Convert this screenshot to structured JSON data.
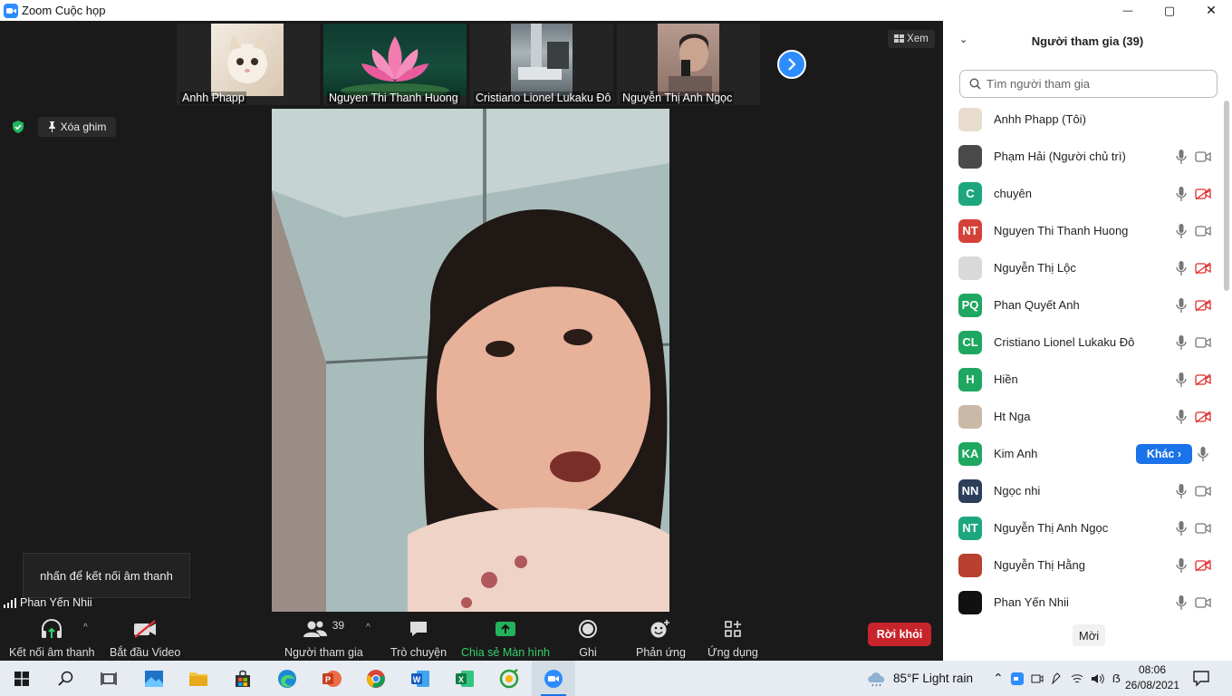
{
  "window": {
    "title": "Zoom Cuộc họp",
    "minimize": "—",
    "maximize": "▢",
    "close": "✕"
  },
  "gallery": {
    "thumbnails": [
      {
        "name": "Anhh Phapp"
      },
      {
        "name": "Nguyen Thi Thanh Huong"
      },
      {
        "name": "Cristiano Lionel Lukaku Đô"
      },
      {
        "name": "Nguyễn Thị Anh Ngọc"
      }
    ],
    "view_label": "Xem"
  },
  "unpin_label": "Xóa ghim",
  "audio_tooltip": "nhấn để kết nối âm thanh",
  "self_name": "Phan Yến Nhii",
  "toolbar": {
    "audio": "Kết nối âm thanh",
    "video": "Bắt đầu Video",
    "participants": "Người tham gia",
    "participants_count": "39",
    "chat": "Trò chuyện",
    "share": "Chia sẻ Màn hình",
    "record": "Ghi",
    "reactions": "Phản ứng",
    "apps": "Ứng dụng",
    "leave": "Rời khỏi"
  },
  "panel": {
    "title": "Người tham gia (39)",
    "search_placeholder": "Tìm người tham gia",
    "invite": "Mời",
    "more_label": "Khác",
    "participants": [
      {
        "name": "Anhh Phapp (Tôi)",
        "avatar": "",
        "avatar_color": "#e8dccf",
        "mic": false,
        "cam": "none"
      },
      {
        "name": "Phạm Hải (Người chủ trì)",
        "avatar": "",
        "avatar_color": "#4a4a4a",
        "mic": true,
        "cam": "on"
      },
      {
        "name": "chuyên",
        "avatar": "C",
        "avatar_color": "#1ea77f",
        "mic": true,
        "cam": "off"
      },
      {
        "name": "Nguyen Thi Thanh Huong",
        "avatar": "NT",
        "avatar_color": "#d4413a",
        "mic": true,
        "cam": "on"
      },
      {
        "name": "Nguyễn Thị Lộc",
        "avatar": "",
        "avatar_color": "#d9d9d9",
        "mic": true,
        "cam": "off"
      },
      {
        "name": "Phan Quyết Anh",
        "avatar": "PQ",
        "avatar_color": "#1ea760",
        "mic": true,
        "cam": "off"
      },
      {
        "name": "Cristiano Lionel Lukaku Đô",
        "avatar": "CL",
        "avatar_color": "#1ea760",
        "mic": true,
        "cam": "on"
      },
      {
        "name": "Hiền",
        "avatar": "H",
        "avatar_color": "#1ea760",
        "mic": true,
        "cam": "off"
      },
      {
        "name": "Ht Nga",
        "avatar": "",
        "avatar_color": "#cbb9a8",
        "mic": true,
        "cam": "off"
      },
      {
        "name": "Kim Anh",
        "avatar": "KA",
        "avatar_color": "#1ea760",
        "mic": true,
        "cam": "more"
      },
      {
        "name": "Ngọc nhi",
        "avatar": "NN",
        "avatar_color": "#2c3e5a",
        "mic": true,
        "cam": "on"
      },
      {
        "name": "Nguyễn Thị Anh Ngọc",
        "avatar": "NT",
        "avatar_color": "#1ea77f",
        "mic": true,
        "cam": "on"
      },
      {
        "name": "Nguyễn Thị Hằng",
        "avatar": "",
        "avatar_color": "#b8412f",
        "mic": true,
        "cam": "off"
      },
      {
        "name": "Phan Yến Nhii",
        "avatar": "",
        "avatar_color": "#111111",
        "mic": true,
        "cam": "on"
      }
    ]
  },
  "taskbar": {
    "weather": "85°F  Light rain",
    "time": "08:06",
    "date": "26/08/2021"
  },
  "colors": {
    "accent": "#2d8cff",
    "leave": "#c8242c",
    "share_green": "#33d16b"
  }
}
